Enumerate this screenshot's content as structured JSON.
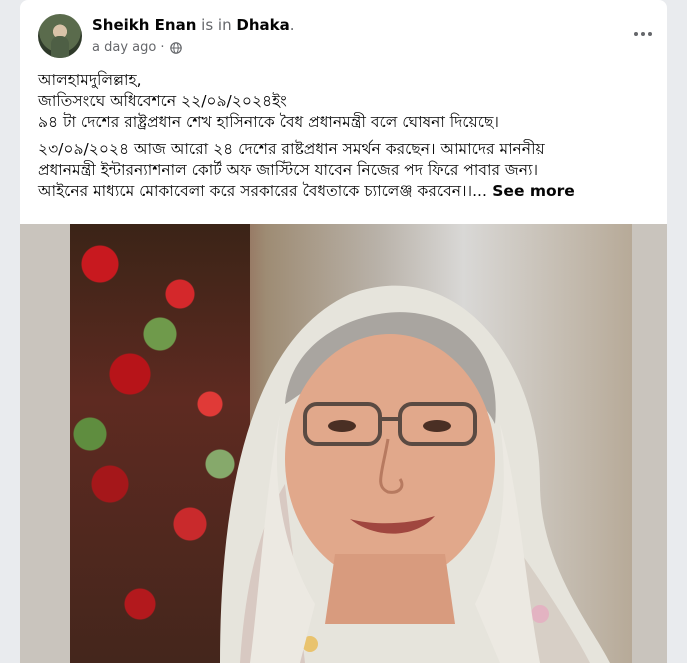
{
  "post": {
    "author": "Sheikh Enan",
    "location_prefix": " is in ",
    "location": "Dhaka",
    "location_suffix": ".",
    "timestamp": "a day ago",
    "separator": "·",
    "privacy_icon": "globe-icon",
    "options_icon": "more-options-icon",
    "text_lines": [
      "আলহামদুলিল্লাহ,",
      "জাতিসংঘে অধিবেশনে ২২/০৯/২০২৪ইং",
      " ৯৪ টা দেশের রাষ্ট্রপ্রধান শেখ হাসিনাকে বৈধ প্রধানমন্ত্রী বলে ঘোষনা দিয়েছে।"
    ],
    "text_lines_2": [
      "২৩/০৯/২০২৪ আজ আরো ২৪ দেশের রাষ্টপ্রধান সমর্থন করছেন। আমাদের মাননীয়",
      "প্রধানমন্ত্রী  ইন্টারন্যাশনাল কোর্ট অফ জাস্টিসে যাবেন নিজের পদ ফিরে পাবার জন্য।",
      "আইনের মাধ্যমে মোকাবেলা করে সরকারের বৈধতাকে চ্যালেঞ্জ করবেন।।..."
    ],
    "see_more": " See more"
  },
  "colors": {
    "background": "#e9ebee",
    "card": "#ffffff",
    "secondary_text": "#65676b",
    "primary_text": "#050505"
  }
}
